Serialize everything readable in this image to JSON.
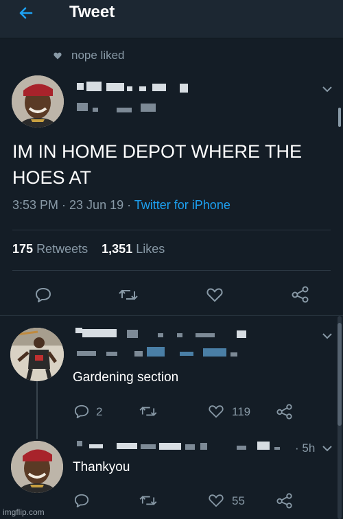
{
  "header": {
    "title": "Tweet"
  },
  "social_context": {
    "text": "nope liked"
  },
  "tweet": {
    "text": "IM IN HOME DEPOT WHERE THE HOES AT",
    "time": "3:53 PM · 23 Jun 19 · ",
    "source": "Twitter for iPhone",
    "retweets_count": "175",
    "retweets_label": "Retweets",
    "likes_count": "1,351",
    "likes_label": "Likes"
  },
  "reply1": {
    "text": "Gardening section",
    "reply_count": "2",
    "like_count": "119"
  },
  "reply2": {
    "text": "Thankyou",
    "time": "· 5h",
    "like_count": "55"
  },
  "watermark": "imgflip.com",
  "colors": {
    "background": "#141d26",
    "header": "#1c2732",
    "secondary_text": "#8899a6",
    "link": "#1da1f2"
  },
  "icons": {
    "back": "back-arrow-icon",
    "reply": "reply-icon",
    "retweet": "retweet-icon",
    "like": "heart-icon",
    "share": "share-icon",
    "more": "chevron-down-icon"
  }
}
